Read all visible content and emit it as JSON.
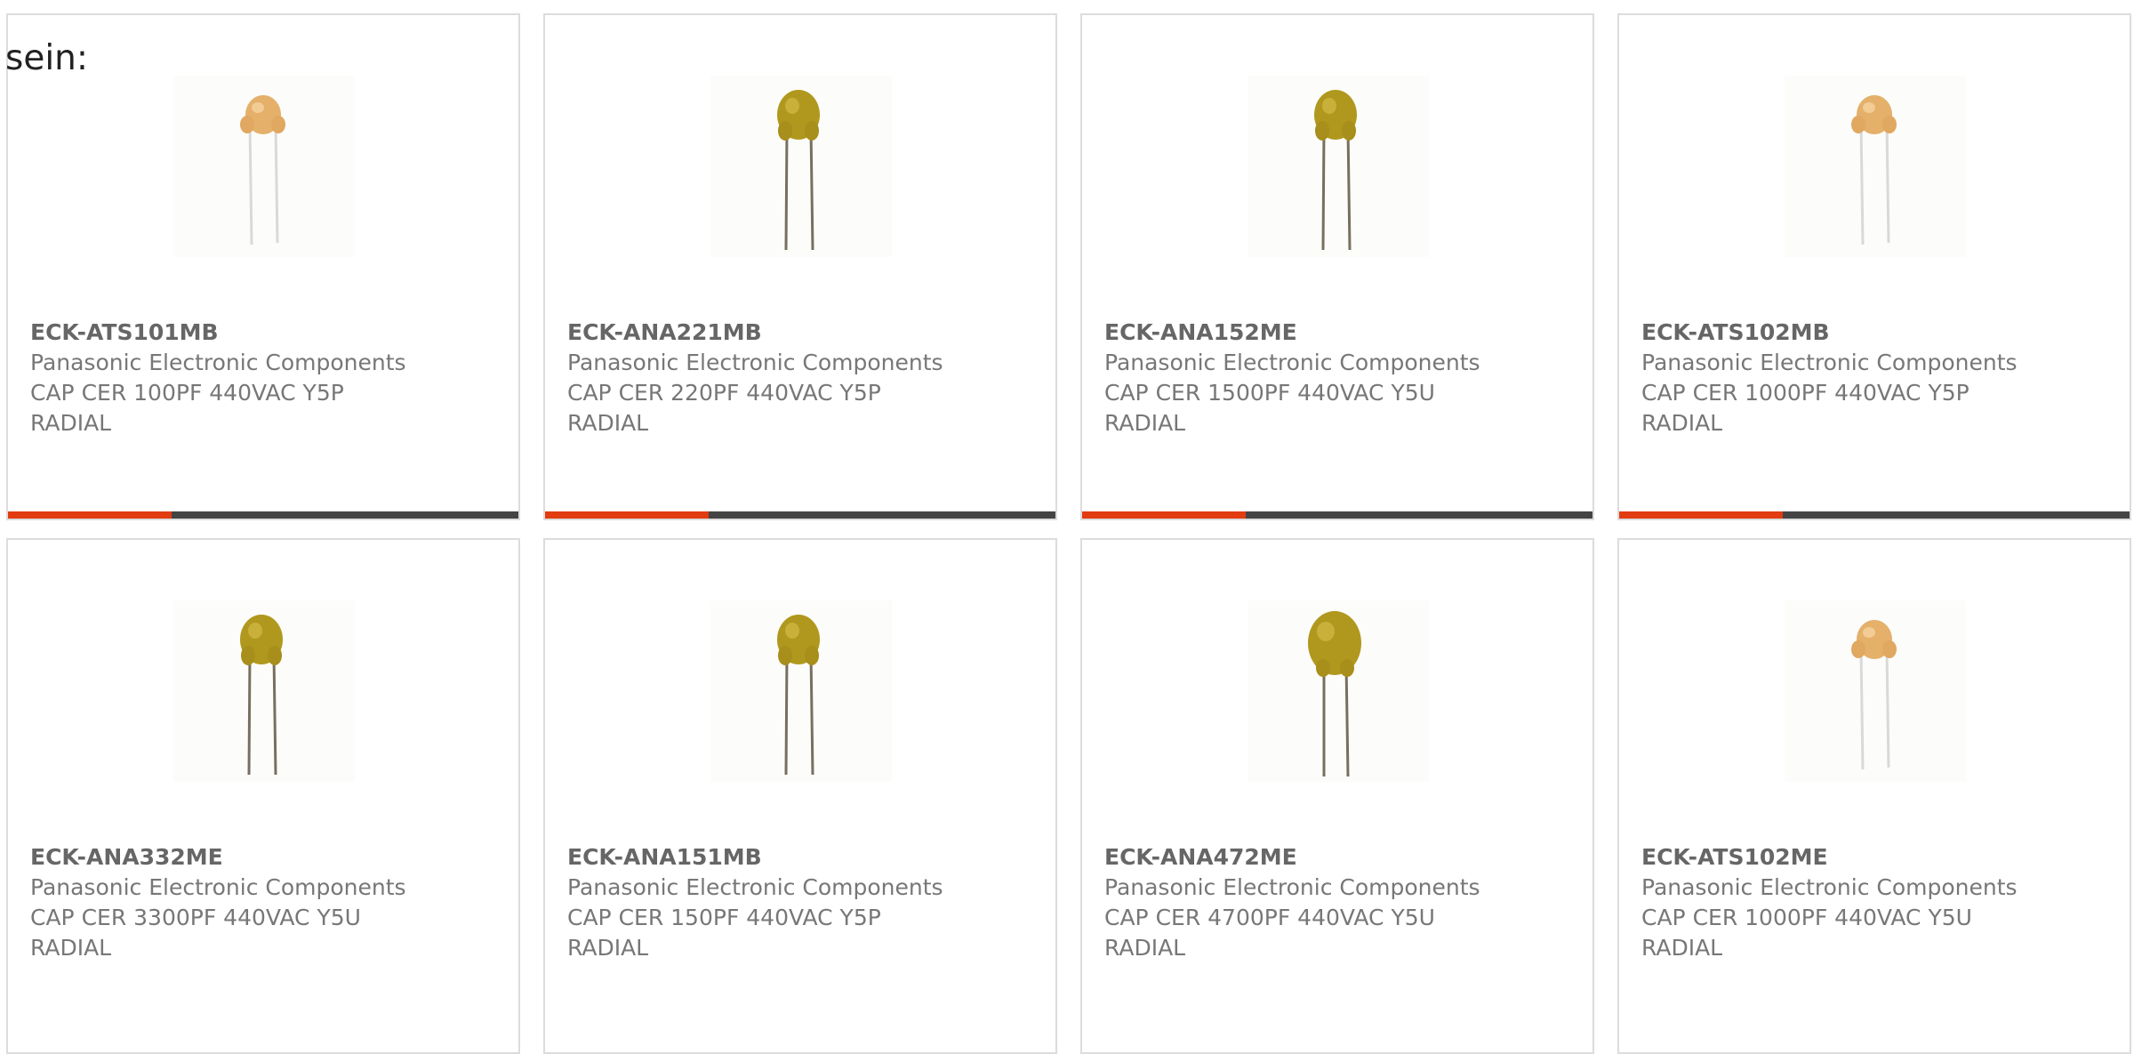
{
  "intro_text": "sein:",
  "accent_color": "#e23c11",
  "bar_color": "#444444",
  "products": [
    {
      "part": "ECK-ATS101MB",
      "maker": "Panasonic Electronic Components",
      "desc1": "CAP CER 100PF 440VAC Y5P",
      "desc2": "RADIAL",
      "image": "small-orange-capacitor-icon",
      "progress": 0.32
    },
    {
      "part": "ECK-ANA221MB",
      "maker": "Panasonic Electronic Components",
      "desc1": "CAP CER 220PF 440VAC Y5P",
      "desc2": "RADIAL",
      "image": "yellow-disc-capacitor-icon",
      "progress": 0.32
    },
    {
      "part": "ECK-ANA152ME",
      "maker": "Panasonic Electronic Components",
      "desc1": "CAP CER 1500PF 440VAC Y5U",
      "desc2": "RADIAL",
      "image": "yellow-disc-capacitor-icon",
      "progress": 0.32
    },
    {
      "part": "ECK-ATS102MB",
      "maker": "Panasonic Electronic Components",
      "desc1": "CAP CER 1000PF 440VAC Y5P",
      "desc2": "RADIAL",
      "image": "small-orange-capacitor-icon",
      "progress": 0.32
    },
    {
      "part": "ECK-ANA332ME",
      "maker": "Panasonic Electronic Components",
      "desc1": "CAP CER 3300PF 440VAC Y5U",
      "desc2": "RADIAL",
      "image": "yellow-disc-capacitor-icon"
    },
    {
      "part": "ECK-ANA151MB",
      "maker": "Panasonic Electronic Components",
      "desc1": "CAP CER 150PF 440VAC Y5P",
      "desc2": "RADIAL",
      "image": "yellow-disc-capacitor-icon"
    },
    {
      "part": "ECK-ANA472ME",
      "maker": "Panasonic Electronic Components",
      "desc1": "CAP CER 4700PF 440VAC Y5U",
      "desc2": "RADIAL",
      "image": "large-yellow-disc-capacitor-icon"
    },
    {
      "part": "ECK-ATS102ME",
      "maker": "Panasonic Electronic Components",
      "desc1": "CAP CER 1000PF 440VAC Y5U",
      "desc2": "RADIAL",
      "image": "small-orange-capacitor-icon"
    }
  ]
}
